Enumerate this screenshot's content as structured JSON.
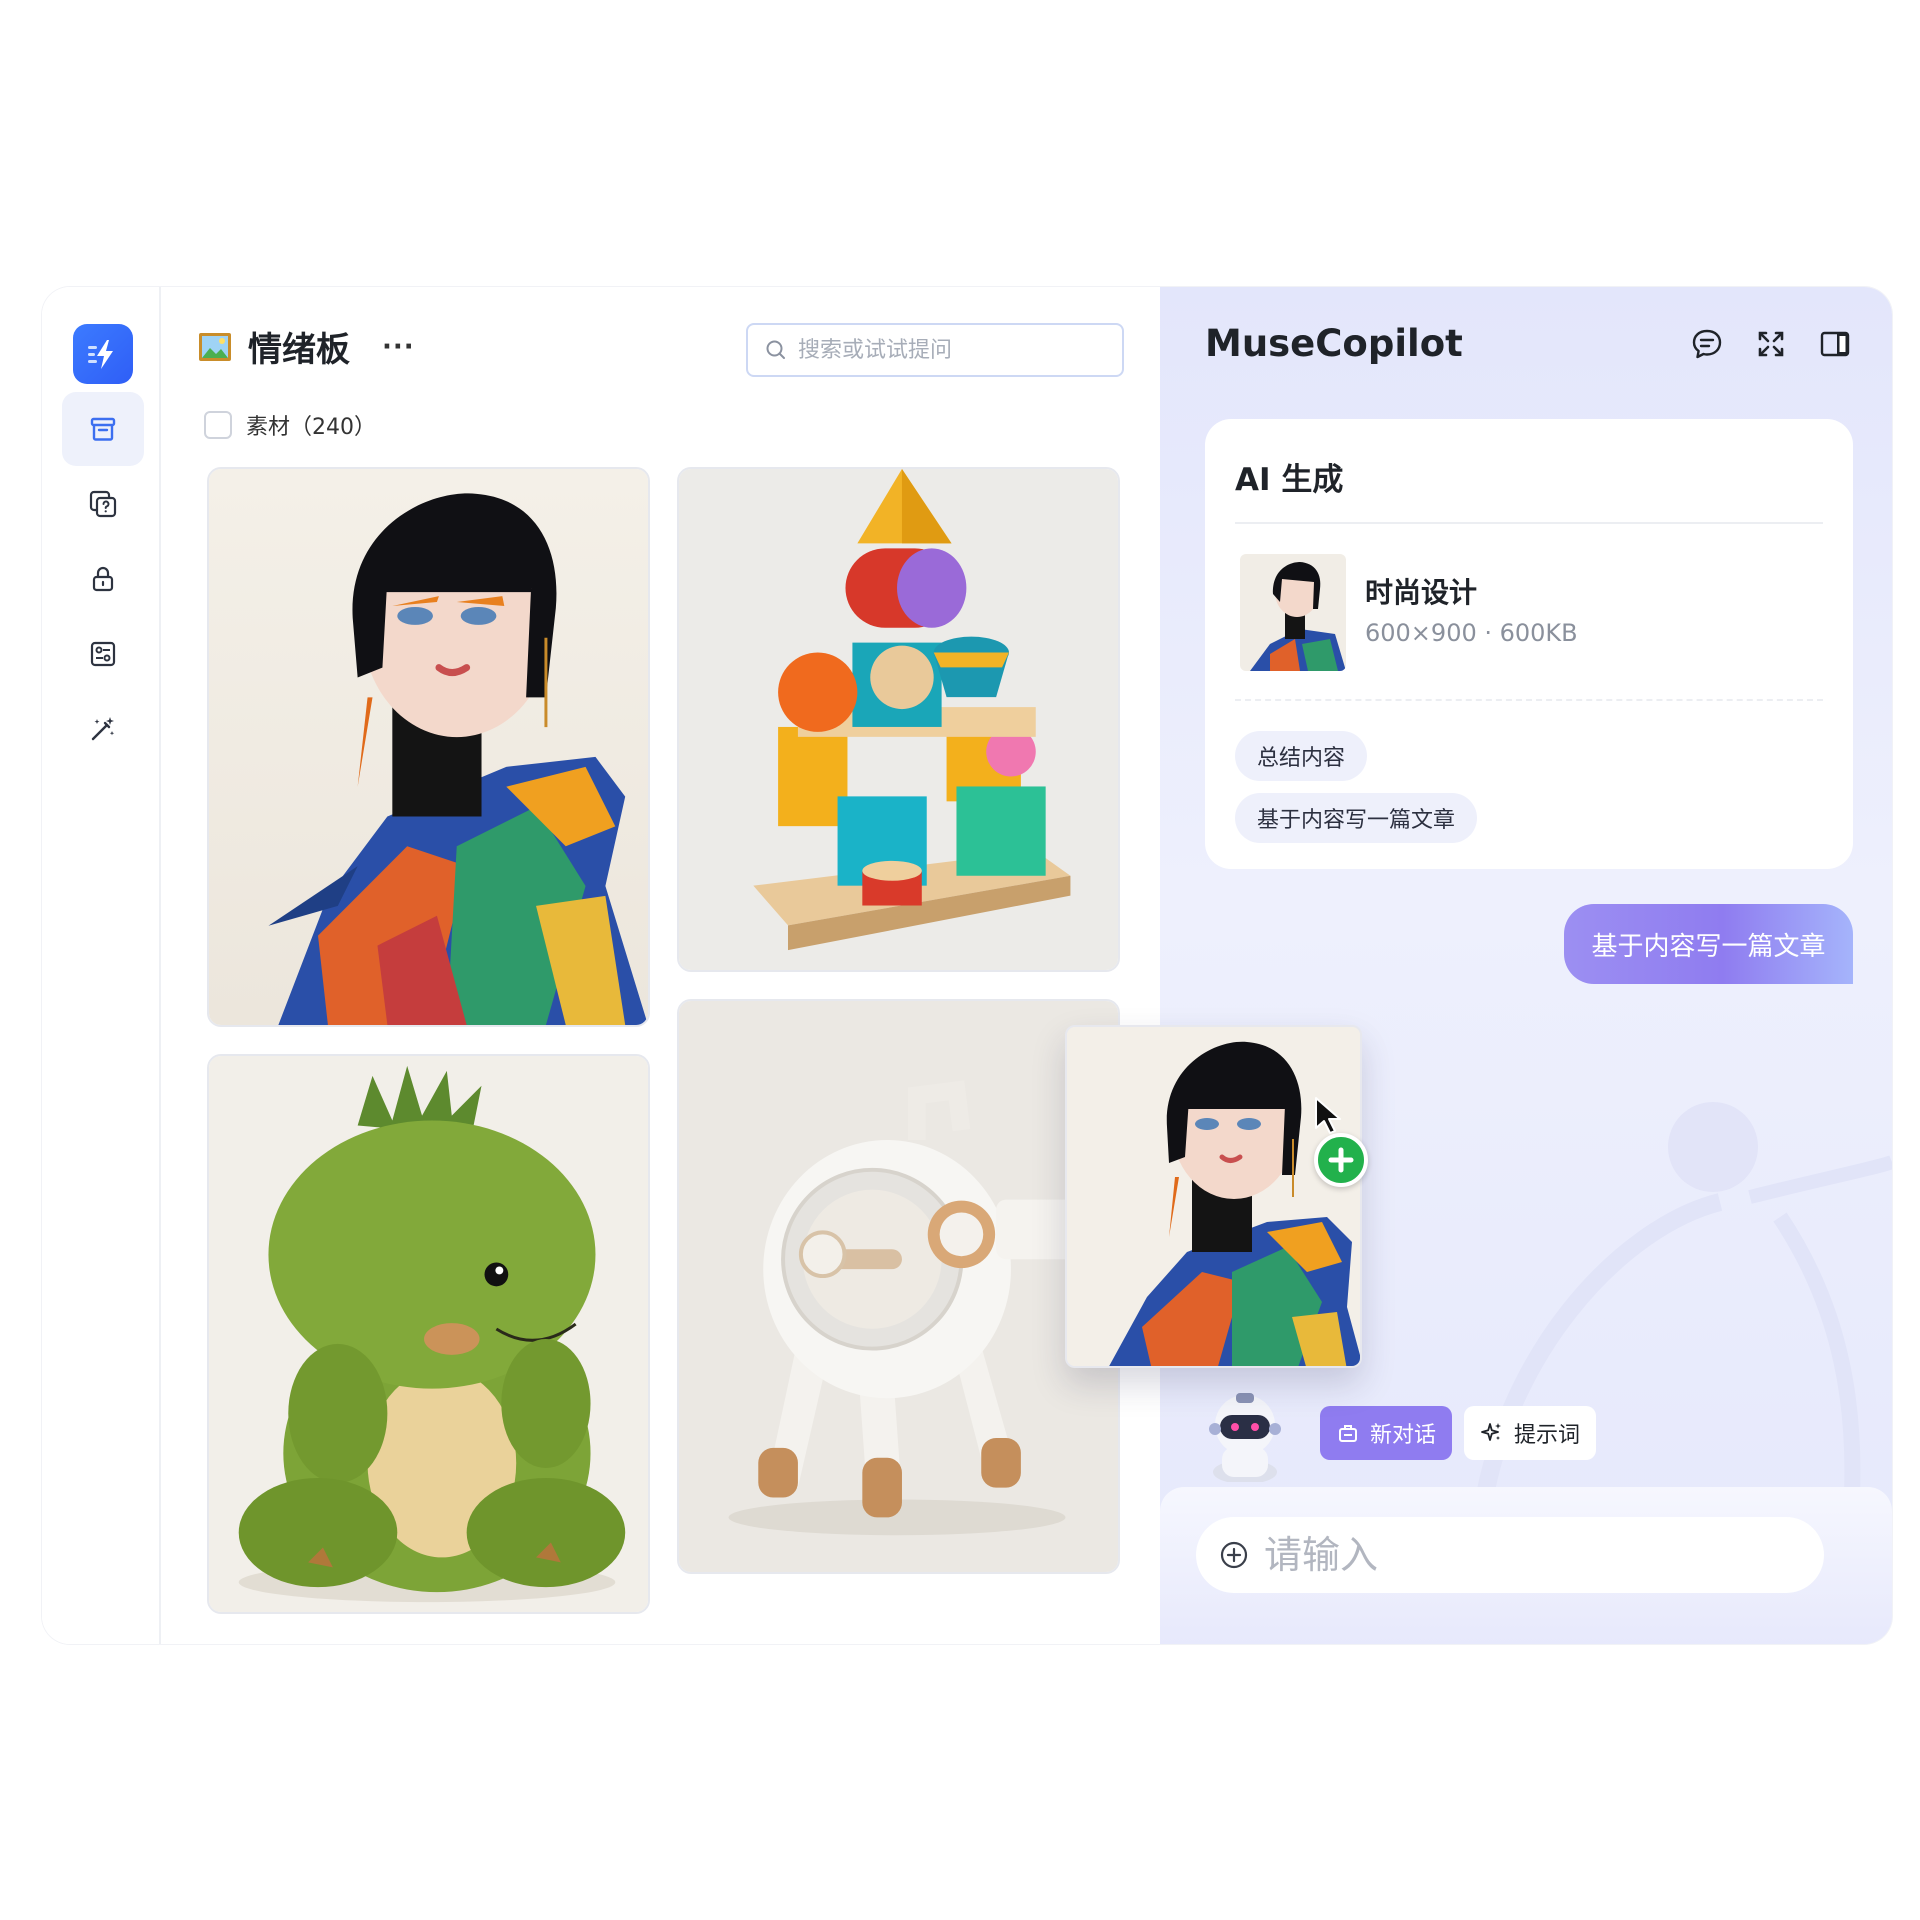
{
  "sidebar": {
    "logo": "flash-logo-icon",
    "items": [
      {
        "icon": "archive-box-icon",
        "active": true
      },
      {
        "icon": "copy-help-icon",
        "active": false
      },
      {
        "icon": "lock-icon",
        "active": false
      },
      {
        "icon": "settings-panel-icon",
        "active": false
      },
      {
        "icon": "magic-wand-icon",
        "active": false
      }
    ]
  },
  "board": {
    "title": "情绪板",
    "more_label": "···",
    "search_placeholder": "搜索或试试提问",
    "select_label": "素材（240）",
    "cards": [
      {
        "name": "fashion-girl-image"
      },
      {
        "name": "wooden-blocks-image"
      },
      {
        "name": "green-dino-plush-image"
      },
      {
        "name": "white-robot-toy-image"
      }
    ]
  },
  "copilot": {
    "title": "MuseCopilot",
    "actions": [
      "chat-bubble-icon",
      "expand-icon",
      "side-panel-icon"
    ],
    "ai_card": {
      "title": "AI 生成",
      "file_name": "时尚设计",
      "file_meta": "600×900 · 600KB",
      "chips": [
        "总结内容",
        "基于内容写一篇文章"
      ]
    },
    "user_message": "基于内容写一篇文章",
    "new_chat_label": "新对话",
    "prompt_label": "提示词",
    "input_placeholder": "请输入"
  },
  "colors": {
    "brand": "#3c7bff",
    "accent_purple": "#8f7cf0",
    "panel_bg": "#e8eafc",
    "add_green": "#22b14c"
  }
}
